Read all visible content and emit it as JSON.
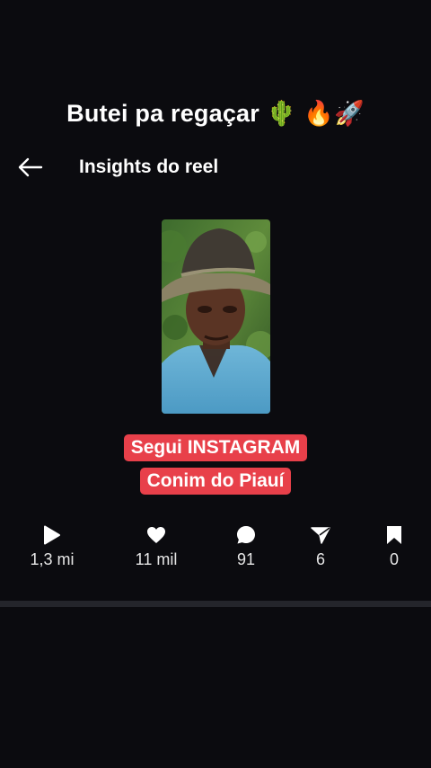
{
  "overlay": {
    "caption": "Butei pa regaçar 🌵 🔥🚀"
  },
  "header": {
    "title": "Insights do reel",
    "back_icon": "arrow-left-icon"
  },
  "thumbnail": {
    "description_icon": "reel-thumbnail"
  },
  "badges": {
    "line1": "Segui INSTAGRAM",
    "line2": "Conim do Piauí",
    "color": "#e8404a"
  },
  "stats": [
    {
      "icon": "play-icon",
      "value": "1,3 mi"
    },
    {
      "icon": "heart-icon",
      "value": "11 mil"
    },
    {
      "icon": "comment-icon",
      "value": "91"
    },
    {
      "icon": "share-icon",
      "value": "6"
    },
    {
      "icon": "bookmark-icon",
      "value": "0"
    }
  ]
}
